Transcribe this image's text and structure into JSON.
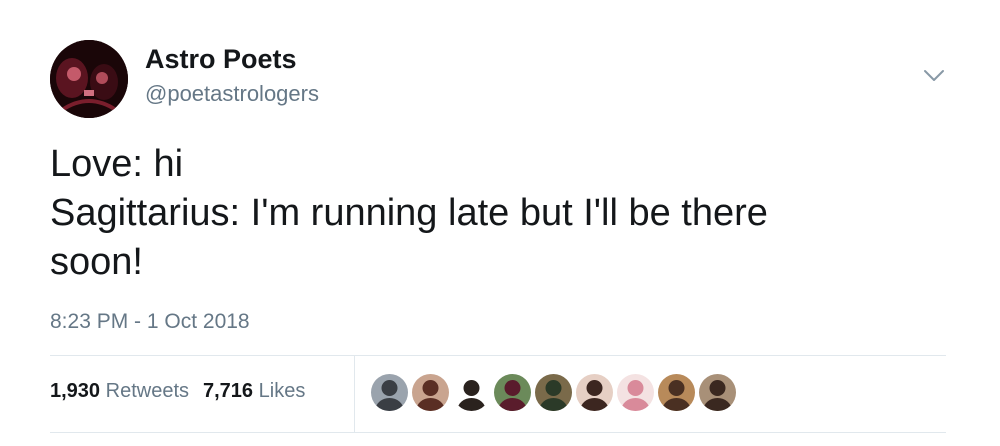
{
  "tweet": {
    "author": {
      "display_name": "Astro Poets",
      "handle": "@poetastrologers",
      "avatar_icon": "profile-photo-avatar"
    },
    "text_lines": [
      "Love: hi",
      "Sagittarius: I'm running late but I'll be there",
      "soon!"
    ],
    "timestamp": "8:23 PM - 1 Oct 2018",
    "stats": {
      "retweets_count": "1,930",
      "retweets_label": "Retweets",
      "likes_count": "7,716",
      "likes_label": "Likes"
    },
    "liker_avatars": [
      {
        "icon": "user-avatar-icon",
        "bg": "#9aa3ad",
        "fg": "#3a3e44"
      },
      {
        "icon": "user-avatar-icon",
        "bg": "#c9a48f",
        "fg": "#5a2e24"
      },
      {
        "icon": "user-avatar-icon",
        "bg": "#ffffff",
        "fg": "#2a221e"
      },
      {
        "icon": "user-avatar-icon",
        "bg": "#6b8a5a",
        "fg": "#5a1c2c"
      },
      {
        "icon": "user-avatar-icon",
        "bg": "#7a6a4a",
        "fg": "#2b3a28"
      },
      {
        "icon": "user-avatar-icon",
        "bg": "#e6cfc4",
        "fg": "#3c2620"
      },
      {
        "icon": "user-avatar-icon",
        "bg": "#f4e2e2",
        "fg": "#d98a9a"
      },
      {
        "icon": "user-avatar-icon",
        "bg": "#b88a5a",
        "fg": "#4a3022"
      },
      {
        "icon": "user-avatar-icon",
        "bg": "#a89078",
        "fg": "#3a2820"
      }
    ],
    "colors": {
      "text_primary": "#14171a",
      "text_secondary": "#657786",
      "divider": "#e1e8ed"
    }
  }
}
